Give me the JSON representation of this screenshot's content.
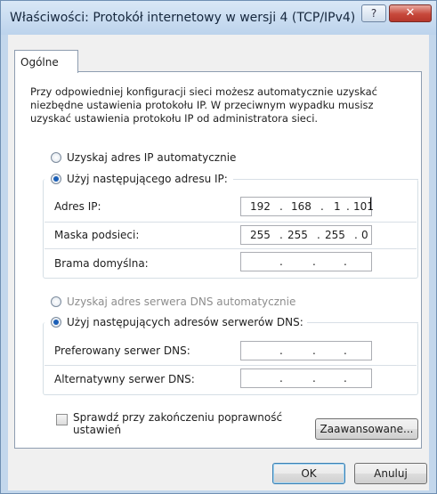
{
  "window": {
    "title": "Właściwości: Protokół internetowy w wersji 4 (TCP/IPv4)",
    "help_label": "?",
    "close_label": "✕"
  },
  "tabs": [
    {
      "label": "Ogólne",
      "selected": true
    }
  ],
  "description": "Przy odpowiedniej konfiguracji sieci możesz automatycznie uzyskać niezbędne ustawienia protokołu IP. W przeciwnym wypadku musisz uzyskać ustawienia protokołu IP od administratora sieci.",
  "ip_section": {
    "auto_label": "Uzyskaj adres IP automatycznie",
    "auto_selected": false,
    "manual_label": "Użyj następującego adresu IP:",
    "manual_selected": true,
    "fields": [
      {
        "label": "Adres IP:",
        "octets": [
          "192",
          "168",
          "1",
          "101"
        ]
      },
      {
        "label": "Maska podsieci:",
        "octets": [
          "255",
          "255",
          "255",
          "0"
        ]
      },
      {
        "label": "Brama domyślna:",
        "octets": [
          "",
          "",
          "",
          ""
        ]
      }
    ]
  },
  "dns_section": {
    "auto_label": "Uzyskaj adres serwera DNS automatycznie",
    "auto_selected": false,
    "auto_disabled": true,
    "manual_label": "Użyj następujących adresów serwerów DNS:",
    "manual_selected": true,
    "fields": [
      {
        "label": "Preferowany serwer DNS:",
        "octets": [
          "",
          "",
          "",
          ""
        ]
      },
      {
        "label": "Alternatywny serwer DNS:",
        "octets": [
          "",
          "",
          "",
          ""
        ]
      }
    ]
  },
  "validate": {
    "label": "Sprawdź przy zakończeniu poprawność ustawień",
    "checked": false
  },
  "buttons": {
    "advanced": "Zaawansowane...",
    "ok": "OK",
    "cancel": "Anuluj"
  },
  "separator_dot": "."
}
